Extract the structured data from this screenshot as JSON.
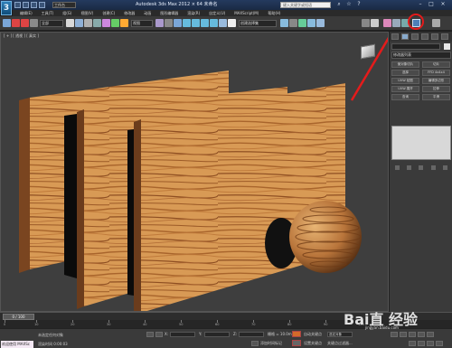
{
  "app": {
    "logo_letter": "3",
    "title": "Autodesk 3ds Max 2012",
    "title_suffix": "  × 64 未命名",
    "workspace": "工作台",
    "search_placeholder": "键入关键字或短语"
  },
  "menu": [
    "编辑(E)",
    "工具(T)",
    "组(G)",
    "视图(V)",
    "创建(C)",
    "修改器",
    "动画",
    "图形编辑器",
    "渲染(R)",
    "自定义(U)",
    "MAXScript(M)",
    "帮助(H)"
  ],
  "toolbar": {
    "selection_filter": "全部",
    "ref_coord": "视图",
    "named_sel": "创建选择集"
  },
  "viewport": {
    "label": "[ + ] [ 透视 ] [ 真实 ]"
  },
  "command_panel": {
    "modifier_list": "修改器列表",
    "buttons": [
      "使对象切片",
      "切片",
      "选择",
      "FFD 4x4x4",
      "UVW 贴图",
      "编辑多边形",
      "UVW 展开",
      "拉伸",
      "查询",
      "平滑"
    ]
  },
  "timeline": {
    "frame": "0 / 100",
    "ticks": [
      "0",
      "10",
      "20",
      "30",
      "40",
      "50",
      "60",
      "70",
      "80",
      "90",
      "100"
    ]
  },
  "status": {
    "selected": "未选定任何对象",
    "render_time": "渲染时间 0:00:03",
    "maxscript": "欢迎使用 MAXSc",
    "x_label": "X:",
    "y_label": "Y:",
    "z_label": "Z:",
    "grid": "栅格 = 10.0mm",
    "autokey": "自动关键点",
    "setkey": "设置关键点",
    "selected_obj": "选定对象",
    "keyfilters": "关键点过滤器...",
    "add_time_tag": "添加时间标记"
  },
  "watermark": {
    "brand": "Bai直 经验",
    "url": "jingyan.baidu.com"
  },
  "colors": {
    "annotation_red": "#e41b1b",
    "wood_light": "#d99a52",
    "wood_dark": "#a5612b"
  }
}
